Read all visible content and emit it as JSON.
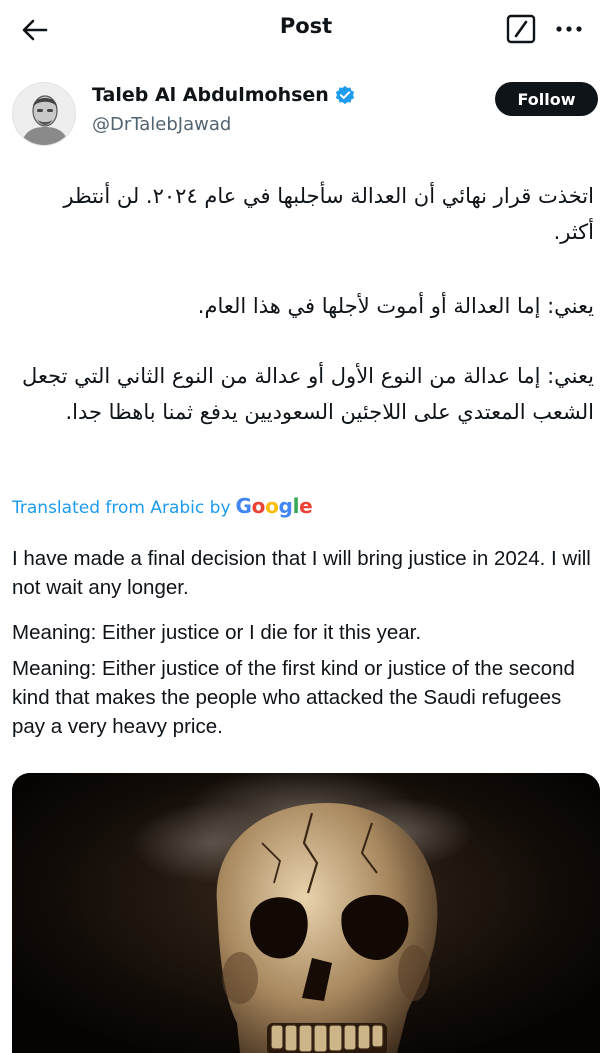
{
  "header": {
    "title": "Post",
    "back_icon": "arrow-left-icon",
    "edit_icon": "edit-icon",
    "more_icon": "more-dots-icon"
  },
  "author": {
    "name": "Taleb Al Abdulmohsen",
    "handle": "@DrTalebJawad",
    "verified": true,
    "follow_label": "Follow"
  },
  "post": {
    "arabic_paragraphs": [
      "اتخذت قرار نهائي أن العدالة سأجلبها في عام ٢٠٢٤. لن أنتظر أكثر.",
      "يعني: إما العدالة أو أموت لأجلها في هذا العام.",
      "يعني: إما عدالة من النوع الأول أو عدالة من النوع الثاني التي تجعل الشعب المعتدي على اللاجئين السعوديين يدفع ثمنا باهظا جدا."
    ],
    "translation_label": "Translated from Arabic by",
    "translation_provider": "Google",
    "english_paragraphs": [
      "I have made a final decision that I will bring justice in 2024. I will not wait any longer.",
      "Meaning: Either justice or I die for it this year.",
      "Meaning: Either justice of the first kind or justice of the second kind that makes the people who attacked the Saudi refugees pay a very heavy price."
    ]
  },
  "colors": {
    "link_blue": "#1d9bf0",
    "verified_blue": "#1d9bf0",
    "text": "#0f1419",
    "secondary": "#536471"
  }
}
